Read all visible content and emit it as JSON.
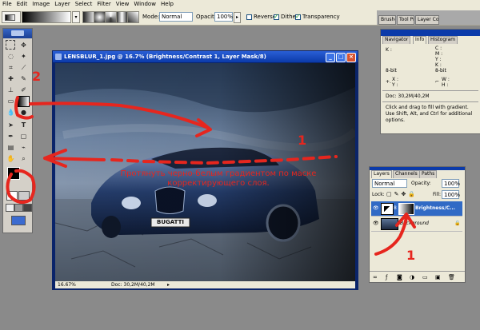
{
  "menu": [
    "File",
    "Edit",
    "Image",
    "Layer",
    "Select",
    "Filter",
    "View",
    "Window",
    "Help"
  ],
  "options": {
    "mode_label": "Mode:",
    "mode_value": "Normal",
    "opacity_label": "Opacity:",
    "opacity_value": "100%",
    "reverse_label": "Reverse",
    "dither_label": "Dither",
    "transparency_label": "Transparency",
    "reverse_checked": false,
    "dither_checked": true,
    "transparency_checked": true
  },
  "well_tabs": [
    "Brushes",
    "Tool Pr",
    "Layer Comps"
  ],
  "document": {
    "title": "LENSBLUR_1.jpg @ 16.7% (Brightness/Contrast 1, Layer Mask/8)",
    "zoom": "16.67%",
    "doc_size": "Doc: 30,2M/40,2M",
    "plate": "BUGATTI"
  },
  "info_panel": {
    "tabs": [
      "Navigator",
      "Info",
      "Histogram"
    ],
    "k1": "K :",
    "bit1": "8-bit",
    "c": "C :",
    "m": "M :",
    "y": "Y :",
    "k2": "K :",
    "bit2": "8-bit",
    "x": "X :",
    "y2": "Y :",
    "w": "W :",
    "h": "H :",
    "doc": "Doc: 30,2M/40,2M",
    "hint": "Click and drag to fill with gradient. Use Shift, Alt, and Ctrl for additional options."
  },
  "layers_panel": {
    "tabs": [
      "Layers",
      "Channels",
      "Paths"
    ],
    "mode_value": "Normal",
    "opacity_label": "Opacity:",
    "opacity_value": "100%",
    "lock_label": "Lock:",
    "fill_label": "Fill:",
    "fill_value": "100%",
    "layers": [
      {
        "name": "Brightness/C..."
      },
      {
        "name": "Background"
      }
    ]
  },
  "annotation": {
    "text_line1": "Протянуть черно-белым градиентом по маске",
    "text_line2": "корректирующего слоя.",
    "num2": "2",
    "num1a": "1",
    "num1b": "1"
  },
  "colors": {
    "annotation_red": "#e6261e",
    "title_bar_blue": "#0b3aa9",
    "ui_gray": "#ece9d8"
  }
}
